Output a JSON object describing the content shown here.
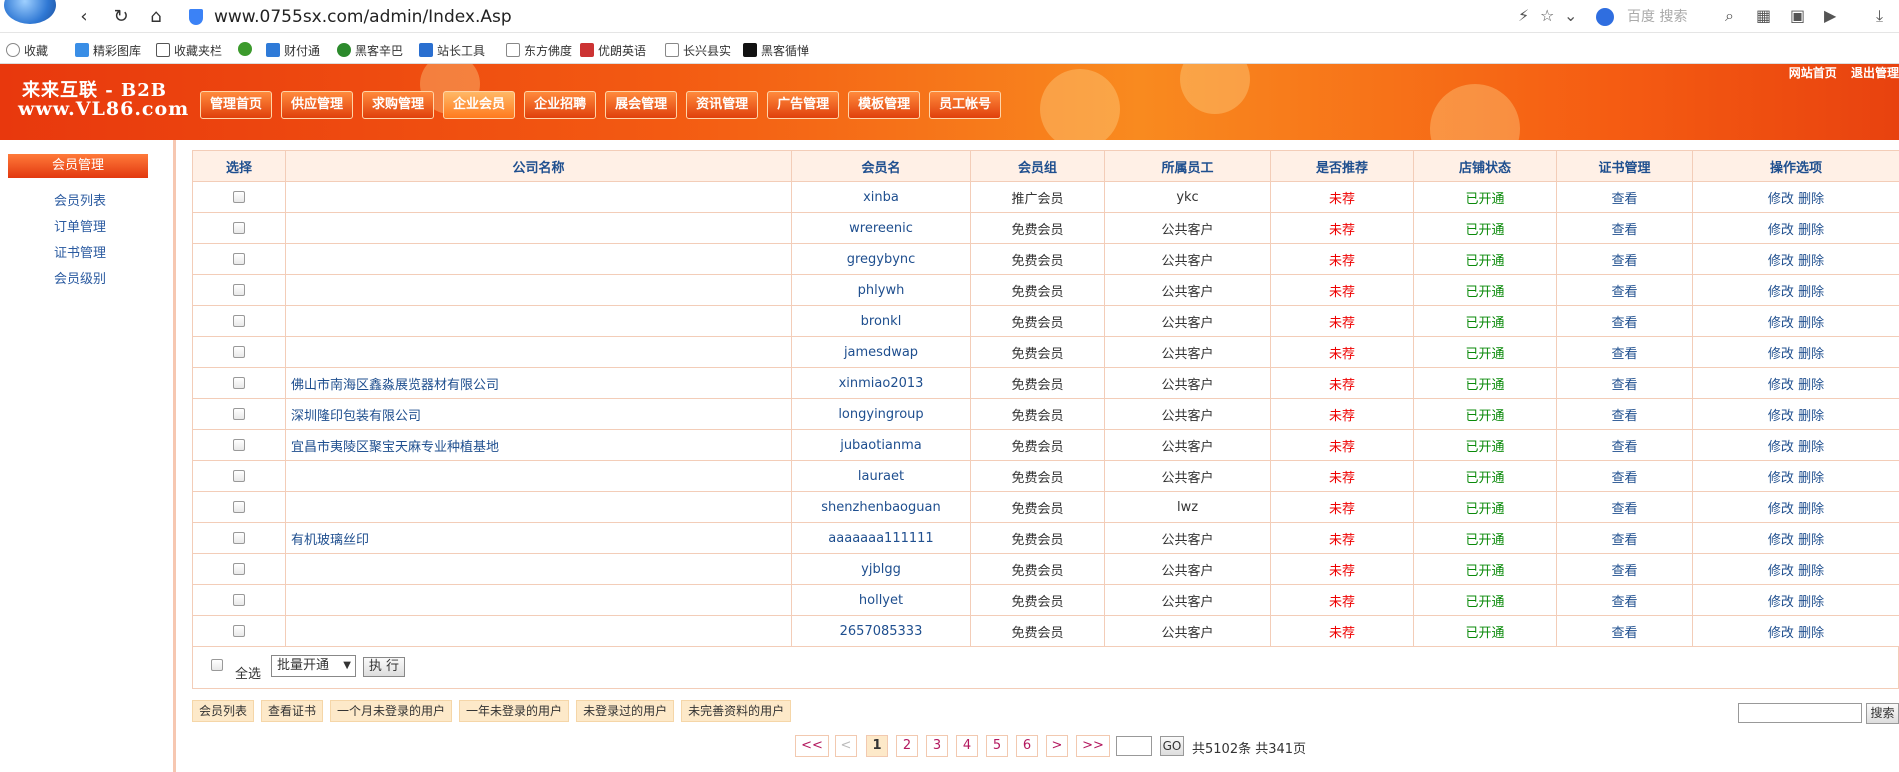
{
  "browser": {
    "url": "www.0755sx.com/admin/Index.Asp",
    "search_placeholder": "百度 搜索",
    "favorites": [
      "收藏",
      "精彩图库",
      "收藏夹栏",
      "财付通",
      "黑客辛巴",
      "站长工具",
      "东方佛度",
      "优朗英语",
      "长兴县实",
      "黑客循惮"
    ]
  },
  "header": {
    "brand_line1": "来来互联 - B2B",
    "brand_line2": "www.VL86.com",
    "top_links": [
      "网站首页",
      "退出管理"
    ],
    "nav_tabs": [
      "管理首页",
      "供应管理",
      "求购管理",
      "企业会员",
      "企业招聘",
      "展会管理",
      "资讯管理",
      "广告管理",
      "模板管理",
      "员工帐号"
    ],
    "active_tab": "企业会员"
  },
  "sidebar": {
    "title": "会员管理",
    "items": [
      "会员列表",
      "订单管理",
      "证书管理",
      "会员级别"
    ]
  },
  "table": {
    "headers": [
      "选择",
      "公司名称",
      "会员名",
      "会员组",
      "所属员工",
      "是否推荐",
      "店铺状态",
      "证书管理",
      "操作选项"
    ],
    "rows": [
      {
        "company": "",
        "member": "xinba",
        "group": "推广会员",
        "staff": "ykc",
        "recommend": "未荐",
        "shop": "已开通",
        "cert": "查看",
        "edit": "修改",
        "del": "删除"
      },
      {
        "company": "",
        "member": "wrereenic",
        "group": "免费会员",
        "staff": "公共客户",
        "recommend": "未荐",
        "shop": "已开通",
        "cert": "查看",
        "edit": "修改",
        "del": "删除"
      },
      {
        "company": "",
        "member": "gregybync",
        "group": "免费会员",
        "staff": "公共客户",
        "recommend": "未荐",
        "shop": "已开通",
        "cert": "查看",
        "edit": "修改",
        "del": "删除"
      },
      {
        "company": "",
        "member": "phlywh",
        "group": "免费会员",
        "staff": "公共客户",
        "recommend": "未荐",
        "shop": "已开通",
        "cert": "查看",
        "edit": "修改",
        "del": "删除"
      },
      {
        "company": "",
        "member": "bronkl",
        "group": "免费会员",
        "staff": "公共客户",
        "recommend": "未荐",
        "shop": "已开通",
        "cert": "查看",
        "edit": "修改",
        "del": "删除"
      },
      {
        "company": "",
        "member": "jamesdwap",
        "group": "免费会员",
        "staff": "公共客户",
        "recommend": "未荐",
        "shop": "已开通",
        "cert": "查看",
        "edit": "修改",
        "del": "删除"
      },
      {
        "company": "佛山市南海区鑫淼展览器材有限公司",
        "member": "xinmiao2013",
        "group": "免费会员",
        "staff": "公共客户",
        "recommend": "未荐",
        "shop": "已开通",
        "cert": "查看",
        "edit": "修改",
        "del": "删除"
      },
      {
        "company": "深圳隆印包装有限公司",
        "member": "longyingroup",
        "group": "免费会员",
        "staff": "公共客户",
        "recommend": "未荐",
        "shop": "已开通",
        "cert": "查看",
        "edit": "修改",
        "del": "删除"
      },
      {
        "company": "宜昌市夷陵区聚宝天麻专业种植基地",
        "member": "jubaotianma",
        "group": "免费会员",
        "staff": "公共客户",
        "recommend": "未荐",
        "shop": "已开通",
        "cert": "查看",
        "edit": "修改",
        "del": "删除"
      },
      {
        "company": "",
        "member": "lauraet",
        "group": "免费会员",
        "staff": "公共客户",
        "recommend": "未荐",
        "shop": "已开通",
        "cert": "查看",
        "edit": "修改",
        "del": "删除"
      },
      {
        "company": "",
        "member": "shenzhenbaoguan",
        "group": "免费会员",
        "staff": "lwz",
        "recommend": "未荐",
        "shop": "已开通",
        "cert": "查看",
        "edit": "修改",
        "del": "删除"
      },
      {
        "company": "有机玻璃丝印",
        "member": "aaaaaaa111111",
        "group": "免费会员",
        "staff": "公共客户",
        "recommend": "未荐",
        "shop": "已开通",
        "cert": "查看",
        "edit": "修改",
        "del": "删除"
      },
      {
        "company": "",
        "member": "yjblgg",
        "group": "免费会员",
        "staff": "公共客户",
        "recommend": "未荐",
        "shop": "已开通",
        "cert": "查看",
        "edit": "修改",
        "del": "删除"
      },
      {
        "company": "",
        "member": "hollyet",
        "group": "免费会员",
        "staff": "公共客户",
        "recommend": "未荐",
        "shop": "已开通",
        "cert": "查看",
        "edit": "修改",
        "del": "删除"
      },
      {
        "company": "",
        "member": "2657085333",
        "group": "免费会员",
        "staff": "公共客户",
        "recommend": "未荐",
        "shop": "已开通",
        "cert": "查看",
        "edit": "修改",
        "del": "删除"
      }
    ]
  },
  "batch": {
    "select_all_label": "全选",
    "action_value": "批量开通",
    "execute_label": "执 行"
  },
  "filters": [
    "会员列表",
    "查看证书",
    "一个月未登录的用户",
    "一年未登录的用户",
    "未登录过的用户",
    "未完善资料的用户"
  ],
  "search_button": "搜索",
  "pager": {
    "first": "<<",
    "prev": "<",
    "pages": [
      "1",
      "2",
      "3",
      "4",
      "5",
      "6"
    ],
    "current_page": "1",
    "next": ">",
    "last": ">>",
    "go_label": "GO",
    "summary": "共5102条 共341页"
  },
  "colors": {
    "header_orange": "#f35a12",
    "link_blue": "#1f4f8f",
    "not_recommended_red": "#ee0000",
    "open_green": "#0a8a0a"
  }
}
